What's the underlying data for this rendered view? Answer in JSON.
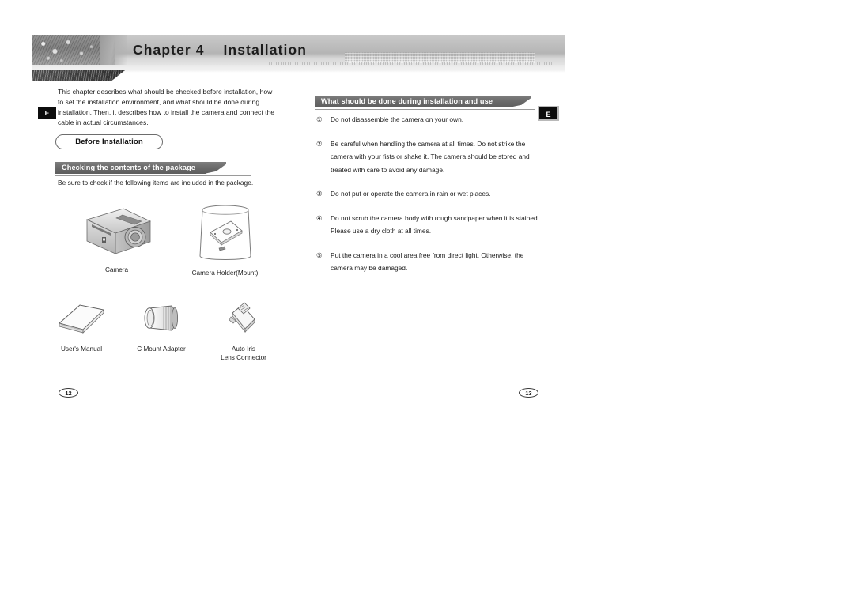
{
  "header": {
    "chapter_label": "Chapter 4",
    "chapter_title": "Installation",
    "chapter_full": "Chapter 4    Installation"
  },
  "left_page": {
    "lang_badge": "E",
    "intro": "This chapter describes what should be checked before installation, how to set the installation environment, and what should be done during installation. Then, it describes how to install the camera and connect the cable in actual circumstances.",
    "pill_heading": "Before Installation",
    "banner_heading": "Checking the contents of the package",
    "subtext": "Be sure to check if the following items are included in the package.",
    "figures": [
      {
        "id": "camera",
        "caption": "Camera"
      },
      {
        "id": "holder",
        "caption": "Camera Holder(Mount)"
      },
      {
        "id": "manual",
        "caption": "User's Manual"
      },
      {
        "id": "cmount",
        "caption": "C Mount Adapter"
      },
      {
        "id": "autoiris",
        "caption": "Auto Iris\nLens Connector"
      }
    ],
    "page_number": "12"
  },
  "right_page": {
    "lang_badge": "E",
    "banner_heading": "What should be done during installation and use",
    "page_number": "13",
    "items": [
      {
        "marker": "①",
        "text": "Do not disassemble the camera on your own."
      },
      {
        "marker": "②",
        "text": "Be careful when handling the camera at all times. Do not strike the camera with your fists or shake it. The camera should be stored and treated with care to avoid any damage."
      },
      {
        "marker": "③",
        "text": "Do not put or operate the camera in rain or wet places."
      },
      {
        "marker": "④",
        "text": "Do not scrub the camera body with rough sandpaper when it is stained. Please use a dry cloth at all times."
      },
      {
        "marker": "⑤",
        "text": "Put the camera in a cool area free from direct light. Otherwise, the camera may be damaged."
      }
    ]
  },
  "colors": {
    "banner_dark": "#6b6b6b",
    "header_band": "#bcbcbc",
    "badge_black": "#0d0d0d",
    "text": "#1a1a1a"
  }
}
